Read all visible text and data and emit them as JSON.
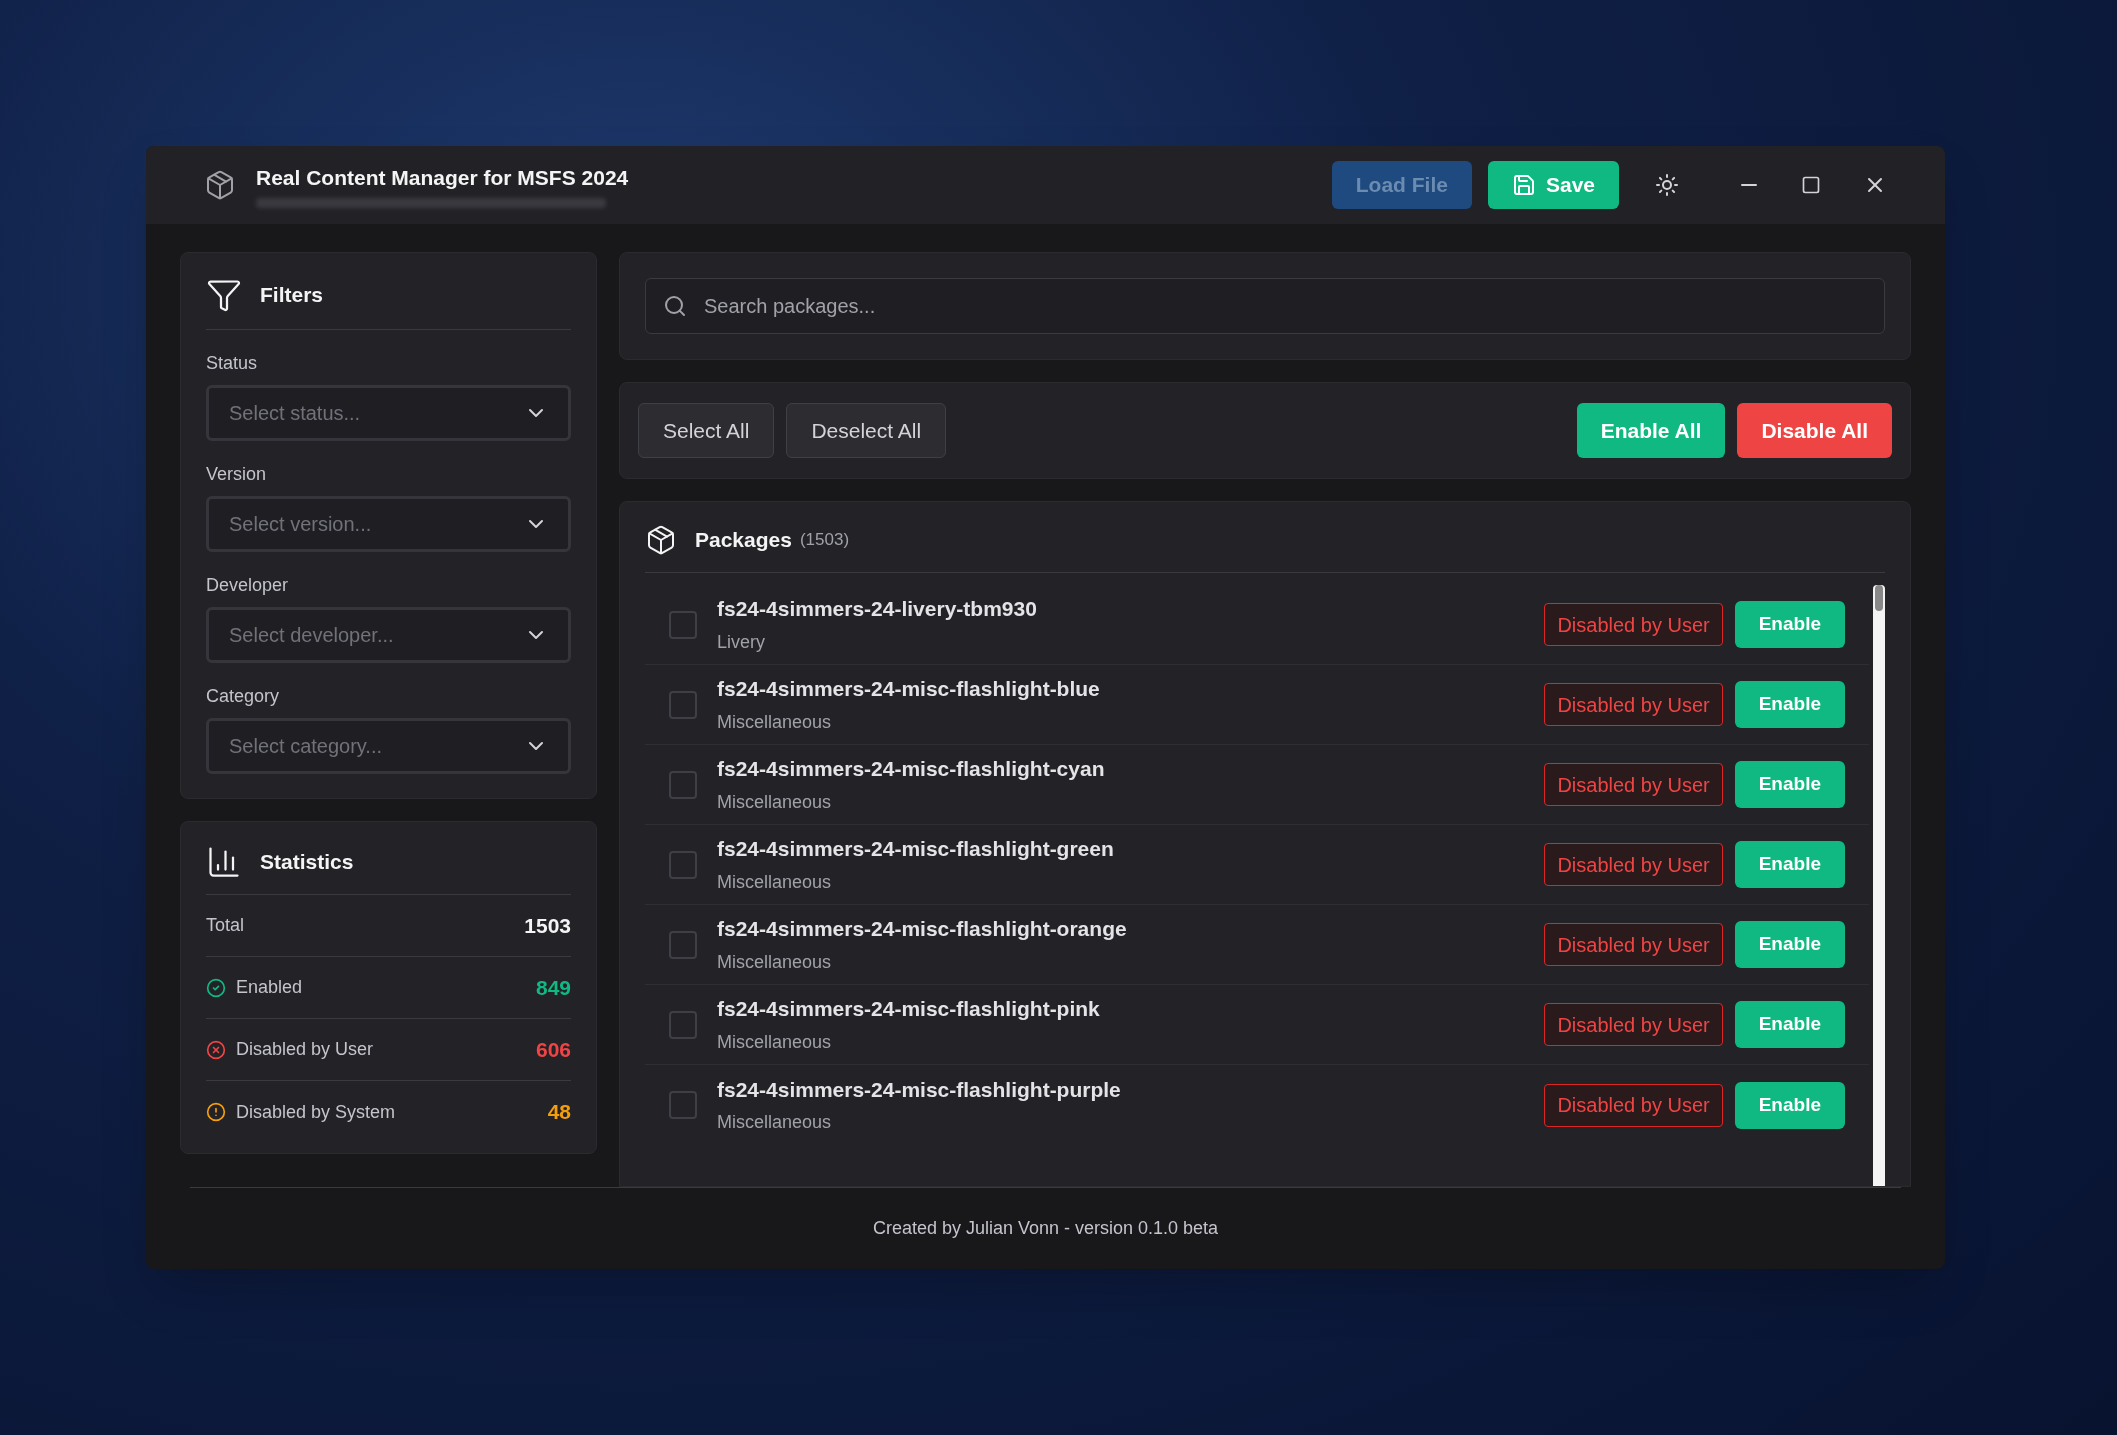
{
  "window": {
    "title": "Real Content Manager for MSFS 2024"
  },
  "header_buttons": [
    {
      "kind": "load",
      "label": "Load File",
      "disabled": true
    },
    {
      "kind": "save",
      "label": "Save",
      "disabled": false
    }
  ],
  "filters": {
    "title": "Filters",
    "fields": [
      {
        "label": "Status",
        "placeholder": "Select status..."
      },
      {
        "label": "Version",
        "placeholder": "Select version..."
      },
      {
        "label": "Developer",
        "placeholder": "Select developer..."
      },
      {
        "label": "Category",
        "placeholder": "Select category..."
      }
    ]
  },
  "statistics": {
    "title": "Statistics",
    "rows": [
      {
        "kind": "total",
        "label": "Total",
        "value": "1503"
      },
      {
        "kind": "enabled",
        "label": "Enabled",
        "value": "849"
      },
      {
        "kind": "user",
        "label": "Disabled by User",
        "value": "606"
      },
      {
        "kind": "system",
        "label": "Disabled by System",
        "value": "48"
      }
    ]
  },
  "search": {
    "placeholder": "Search packages..."
  },
  "actions": [
    {
      "kind": "neutral",
      "label": "Select All"
    },
    {
      "kind": "neutral",
      "label": "Deselect All"
    },
    {
      "kind": "enable",
      "label": "Enable All"
    },
    {
      "kind": "disable",
      "label": "Disable All"
    }
  ],
  "packages": {
    "title": "Packages",
    "count": "(1503)",
    "rows": [
      {
        "name": "fs24-4simmers-24-livery-tbm930",
        "category": "Livery",
        "selected": false,
        "status": "Disabled by User",
        "action": "Enable"
      },
      {
        "name": "fs24-4simmers-24-misc-flashlight-blue",
        "category": "Miscellaneous",
        "selected": false,
        "status": "Disabled by User",
        "action": "Enable"
      },
      {
        "name": "fs24-4simmers-24-misc-flashlight-cyan",
        "category": "Miscellaneous",
        "selected": false,
        "status": "Disabled by User",
        "action": "Enable"
      },
      {
        "name": "fs24-4simmers-24-misc-flashlight-green",
        "category": "Miscellaneous",
        "selected": false,
        "status": "Disabled by User",
        "action": "Enable"
      },
      {
        "name": "fs24-4simmers-24-misc-flashlight-orange",
        "category": "Miscellaneous",
        "selected": false,
        "status": "Disabled by User",
        "action": "Enable"
      },
      {
        "name": "fs24-4simmers-24-misc-flashlight-pink",
        "category": "Miscellaneous",
        "selected": false,
        "status": "Disabled by User",
        "action": "Enable"
      },
      {
        "name": "fs24-4simmers-24-misc-flashlight-purple",
        "category": "Miscellaneous",
        "selected": false,
        "status": "Disabled by User",
        "action": "Enable"
      }
    ]
  },
  "footer": "Created by Julian Vonn - version 0.1.0 beta"
}
